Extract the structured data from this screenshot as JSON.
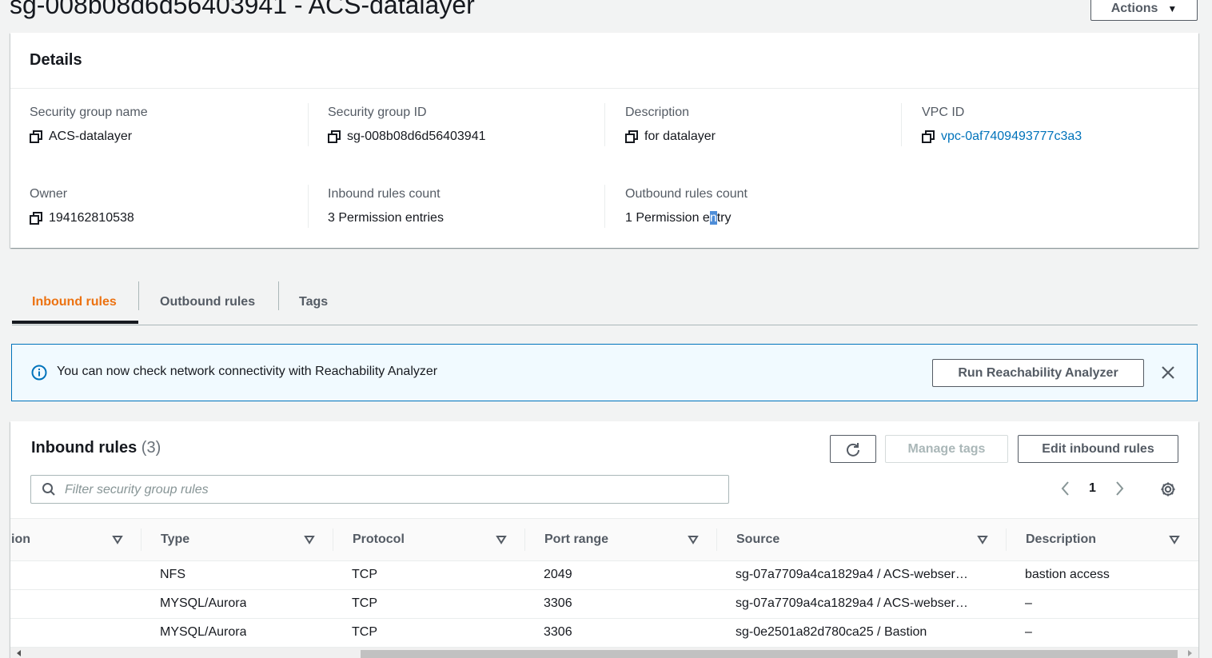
{
  "page": {
    "title": "sg-008b08d6d56403941 - ACS-datalayer",
    "actions_label": "Actions"
  },
  "details": {
    "heading": "Details",
    "fields": [
      {
        "label": "Security group name",
        "value": "ACS-datalayer"
      },
      {
        "label": "Security group ID",
        "value": "sg-008b08d6d56403941"
      },
      {
        "label": "Description",
        "value": "for datalayer"
      },
      {
        "label": "VPC ID",
        "value": "vpc-0af7409493777c3a3"
      },
      {
        "label": "Owner",
        "value": "194162810538"
      },
      {
        "label": "Inbound rules count",
        "value": "3 Permission entries"
      },
      {
        "label": "Outbound rules count",
        "value_pre": "1 Permission e",
        "value_sel": "n",
        "value_post": "try"
      }
    ]
  },
  "tabs": [
    "Inbound rules",
    "Outbound rules",
    "Tags"
  ],
  "flash": {
    "message": "You can now check network connectivity with Reachability Analyzer",
    "button": "Run Reachability Analyzer"
  },
  "rules": {
    "title": "Inbound rules",
    "count": "(3)",
    "manage_tags": "Manage tags",
    "edit_rules": "Edit inbound rules",
    "search_placeholder": "Filter security group rules",
    "page_number": "1",
    "columns": [
      "ion",
      "Type",
      "Protocol",
      "Port range",
      "Source",
      "Description"
    ],
    "rows": [
      {
        "type": "NFS",
        "protocol": "TCP",
        "port": "2049",
        "source": "sg-07a7709a4ca1829a4 / ACS-webser…",
        "description": "bastion access"
      },
      {
        "type": "MYSQL/Aurora",
        "protocol": "TCP",
        "port": "3306",
        "source": "sg-07a7709a4ca1829a4 / ACS-webser…",
        "description": "–"
      },
      {
        "type": "MYSQL/Aurora",
        "protocol": "TCP",
        "port": "3306",
        "source": "sg-0e2501a82d780ca25 / Bastion",
        "description": "–"
      }
    ]
  },
  "colors": {
    "accent": "#ec7211",
    "link": "#0073bb",
    "info": "#0073bb"
  }
}
